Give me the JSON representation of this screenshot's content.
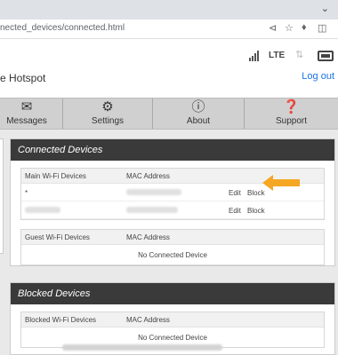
{
  "browser": {
    "url": "nected_devices/connected.html",
    "dropdown_icon": "chevron-down-icon",
    "share_icon": "share-icon",
    "star_icon": "star-icon",
    "extensions_icon": "puzzle-icon",
    "sidebar_icon": "side-panel-icon"
  },
  "header": {
    "title": "e Hotspot",
    "network": "LTE",
    "logout": "Log out"
  },
  "nav": [
    {
      "label": "Messages",
      "icon": "envelope-icon"
    },
    {
      "label": "Settings",
      "icon": "gear-icon"
    },
    {
      "label": "About",
      "icon": "info-icon"
    },
    {
      "label": "Support",
      "icon": "help-icon"
    }
  ],
  "connected": {
    "title": "Connected Devices",
    "main": {
      "col_device": "Main Wi-Fi Devices",
      "col_mac": "MAC Address",
      "rows": [
        {
          "name": "*",
          "edit": "Edit",
          "block": "Block"
        },
        {
          "name": "",
          "edit": "Edit",
          "block": "Block"
        }
      ]
    },
    "guest": {
      "col_device": "Guest Wi-Fi Devices",
      "col_mac": "MAC Address",
      "empty": "No Connected Device"
    }
  },
  "blocked": {
    "title": "Blocked Devices",
    "col_device": "Blocked Wi-Fi Devices",
    "col_mac": "MAC Address",
    "empty": "No Connected Device"
  },
  "colors": {
    "accent": "#f5a623",
    "panel_header": "#3a3a3a",
    "link": "#1a73e8"
  }
}
